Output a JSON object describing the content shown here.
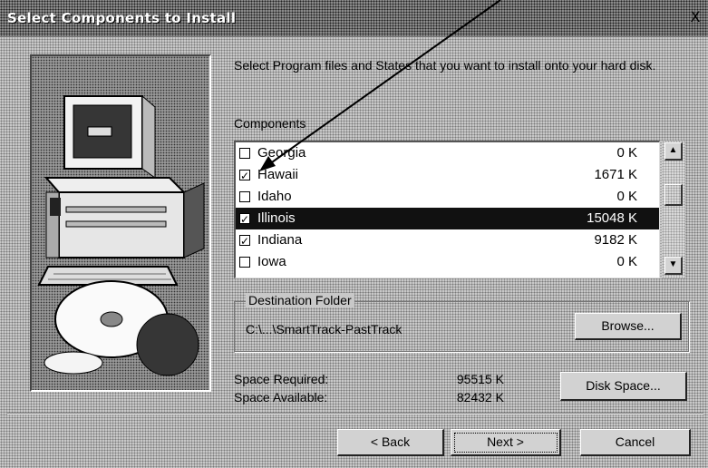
{
  "window": {
    "title": "Select Components to Install",
    "close_glyph": "X"
  },
  "intro_text": "Select Program files and States that you want to install onto your hard disk.",
  "components_label": "Components",
  "components": [
    {
      "name": "Georgia",
      "size": "0 K",
      "checked": false,
      "selected": false
    },
    {
      "name": "Hawaii",
      "size": "1671 K",
      "checked": true,
      "selected": false
    },
    {
      "name": "Idaho",
      "size": "0 K",
      "checked": false,
      "selected": false
    },
    {
      "name": "Illinois",
      "size": "15048 K",
      "checked": true,
      "selected": true
    },
    {
      "name": "Indiana",
      "size": "9182 K",
      "checked": true,
      "selected": false
    },
    {
      "name": "Iowa",
      "size": "0 K",
      "checked": false,
      "selected": false
    }
  ],
  "destination": {
    "label": "Destination Folder",
    "path": "C:\\...\\SmartTrack-PastTrack",
    "browse_label": "Browse..."
  },
  "space": {
    "required_label": "Space Required:",
    "required_value": "95515 K",
    "available_label": "Space Available:",
    "available_value": "82432 K",
    "disk_space_label": "Disk Space..."
  },
  "buttons": {
    "back": "< Back",
    "next": "Next >",
    "cancel": "Cancel"
  },
  "colors": {
    "title_bar": "#8a8a8a",
    "selection": "#111111",
    "list_bg": "#ffffff",
    "dialog_bg": "#c8c8c8"
  },
  "icons": [
    "close-icon",
    "scroll-up-icon",
    "scroll-down-icon",
    "checkbox-icon"
  ]
}
